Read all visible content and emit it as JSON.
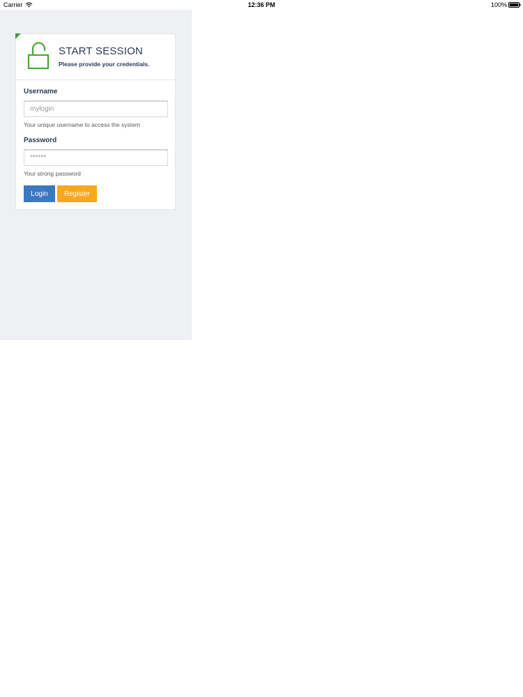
{
  "status_bar": {
    "carrier": "Carrier",
    "time": "12:36 PM",
    "battery": "100%"
  },
  "card": {
    "title": "START SESSION",
    "subtitle": "Please provide your credentials.",
    "accent_color": "#3e9d2f"
  },
  "form": {
    "username": {
      "label": "Username",
      "placeholder": "mylogin",
      "help": "Your unique username to access the system"
    },
    "password": {
      "label": "Password",
      "placeholder": "******",
      "help": "Your strong password"
    },
    "buttons": {
      "login": "Login",
      "register": "Register"
    }
  },
  "icons": [
    "wifi-icon",
    "battery-icon",
    "unlocked-padlock-icon"
  ],
  "colors": {
    "login_button": "#3a78c2",
    "register_button": "#f7a81b",
    "heading_text": "#2c3a57",
    "app_background": "#eef0f3"
  }
}
